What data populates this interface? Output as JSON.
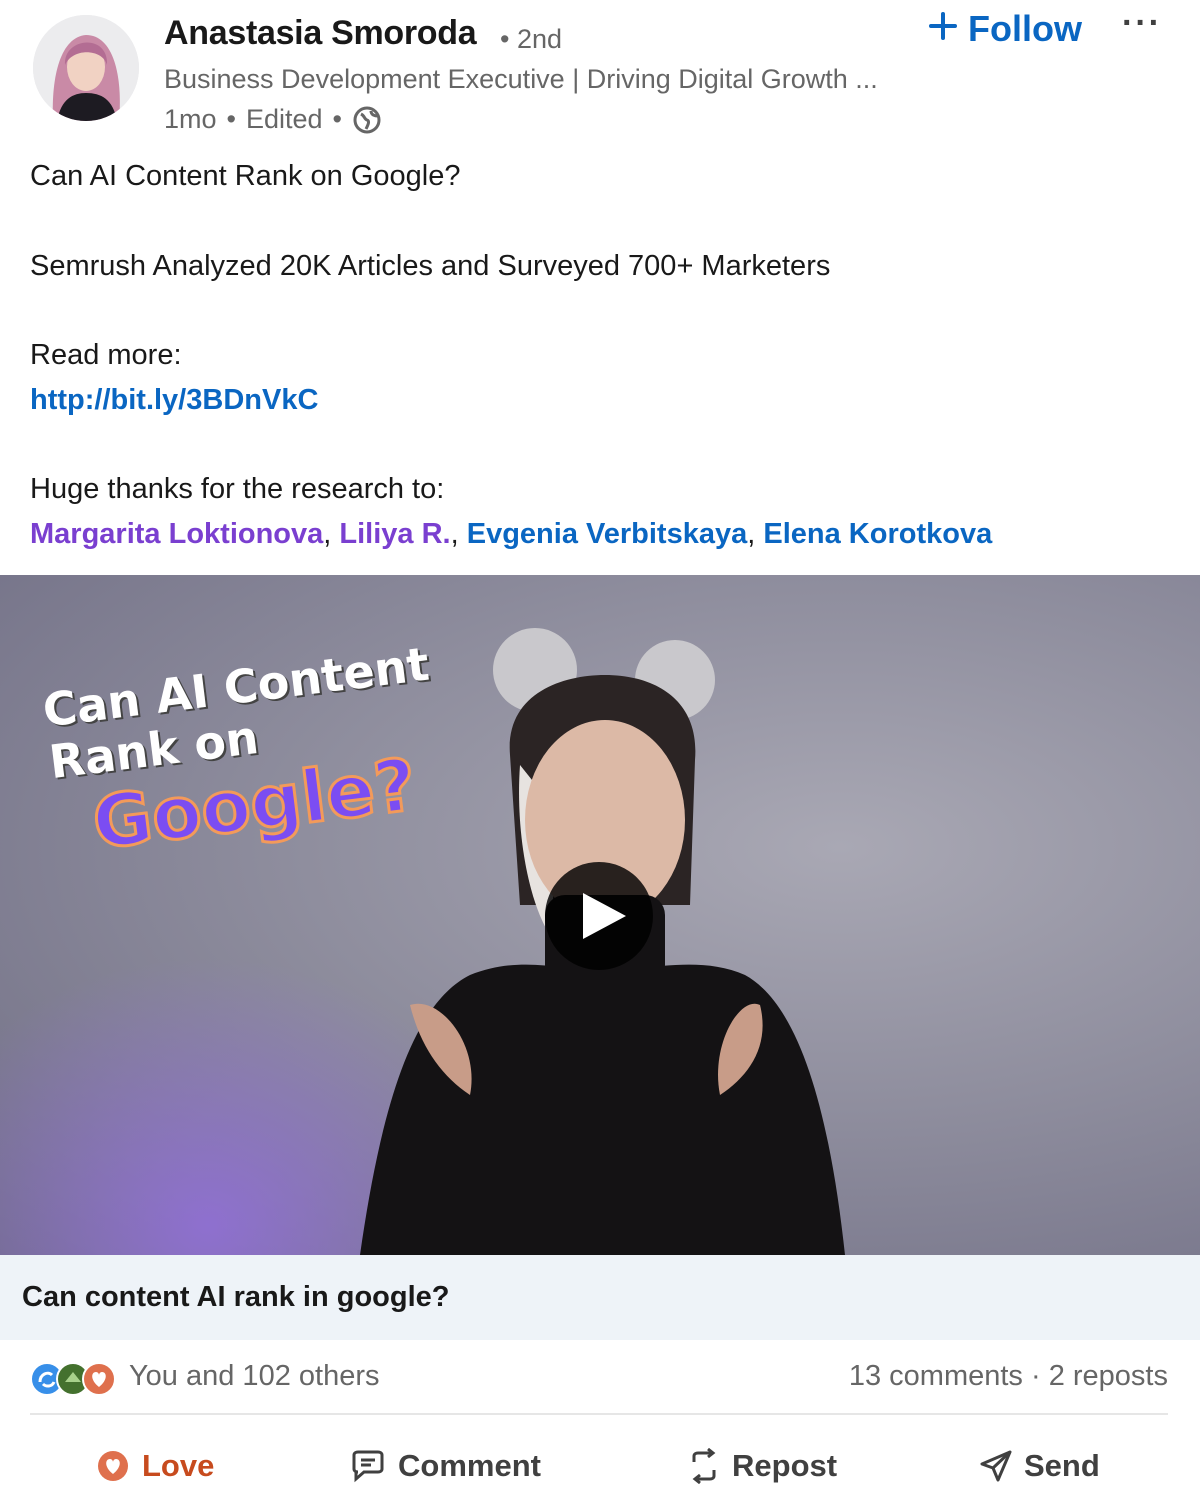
{
  "author": {
    "name": "Anastasia Smoroda",
    "degree": "• 2nd",
    "headline": "Business Development Executive | Driving Digital Growth ...",
    "time": "1mo",
    "dot1": "•",
    "edited": "Edited",
    "dot2": "•",
    "visibility_icon": "globe-icon"
  },
  "actions_top": {
    "follow_label": "Follow",
    "follow_icon": "plus-icon",
    "more_label": "···"
  },
  "post": {
    "line1": "Can AI Content Rank on Google?",
    "line2": "Semrush Analyzed 20K Articles and Surveyed 700+ Marketers",
    "line3": "Read more:",
    "link": "http://bit.ly/3BDnVkC",
    "line4": "Huge thanks for the research to:",
    "mentions": [
      {
        "name": "Margarita Loktionova",
        "sep": ", "
      },
      {
        "name": "Liliya R.",
        "sep": ", "
      },
      {
        "name": "Evgenia Verbitskaya",
        "sep": ", "
      },
      {
        "name": "Elena Korotkova",
        "sep": ""
      }
    ]
  },
  "video": {
    "overlay_line1": "Can AI Content",
    "overlay_line2": "Rank on",
    "overlay_line3": "Google?",
    "play_icon": "play-icon",
    "caption": "Can content AI rank in google?"
  },
  "social": {
    "reactions_label": "You and 102 others",
    "reaction_icons": [
      "clap-icon",
      "support-icon",
      "love-icon"
    ],
    "comments": "13 comments",
    "sep": " · ",
    "reposts": "2 reposts"
  },
  "actions": {
    "love": "Love",
    "comment": "Comment",
    "repost": "Repost",
    "send": "Send"
  },
  "colors": {
    "accent": "#0a66c2",
    "love": "#c74b1e",
    "mention_purple": "#7a3fd0"
  }
}
